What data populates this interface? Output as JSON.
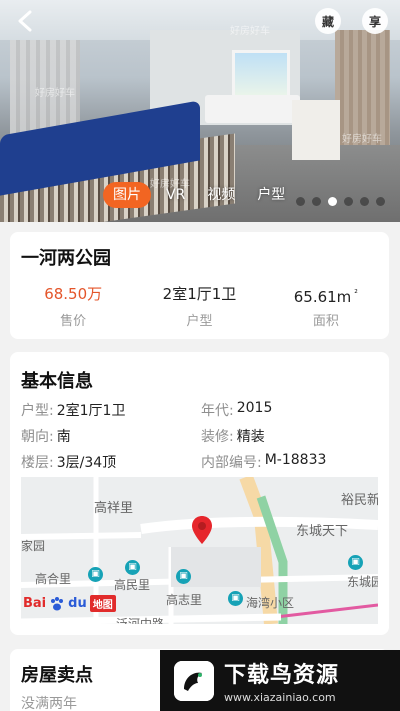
{
  "hero": {
    "watermarks": [
      "好房好车",
      "好房好车",
      "好房好车",
      "好房好车"
    ],
    "fav_label": "藏",
    "share_label": "享",
    "media_tabs": [
      {
        "label": "图片",
        "active": true
      },
      {
        "label": "VR",
        "active": false
      },
      {
        "label": "视频",
        "active": false
      },
      {
        "label": "户型",
        "active": false
      }
    ],
    "dots_total": 6,
    "dots_active_index": 2,
    "accent_color": "#f26522"
  },
  "listing": {
    "title": "一河两公园",
    "stats": [
      {
        "value": "68.50万",
        "label": "售价"
      },
      {
        "value": "2室1厅1卫",
        "label": "户型"
      },
      {
        "value": "65.61m",
        "sup": "²",
        "label": "面积"
      }
    ],
    "price_color": "#e4552a"
  },
  "basic_info": {
    "title": "基本信息",
    "rows": [
      [
        {
          "key": "户型:",
          "value": "2室1厅1卫"
        },
        {
          "key": "年代:",
          "value": "2015"
        }
      ],
      [
        {
          "key": "朝向:",
          "value": "南"
        },
        {
          "key": "装修:",
          "value": "精装"
        }
      ],
      [
        {
          "key": "楼层:",
          "value": "3层/34顶"
        },
        {
          "key": "内部编号:",
          "value": "M-18833"
        }
      ]
    ]
  },
  "map": {
    "labels": [
      "高祥里",
      "裕民新",
      "东城天下",
      "家园",
      "高合里",
      "高民里",
      "东城园",
      "高志里",
      "海湾小区",
      "泛河中路"
    ],
    "brand": {
      "bai": "Bai",
      "du": "du",
      "ditu": "地图"
    }
  },
  "selling_points": {
    "title": "房屋卖点",
    "subtitle": "没满两年"
  },
  "watermark_badge": {
    "name": "下载鸟资源",
    "url": "www.xiazainiao.com"
  }
}
